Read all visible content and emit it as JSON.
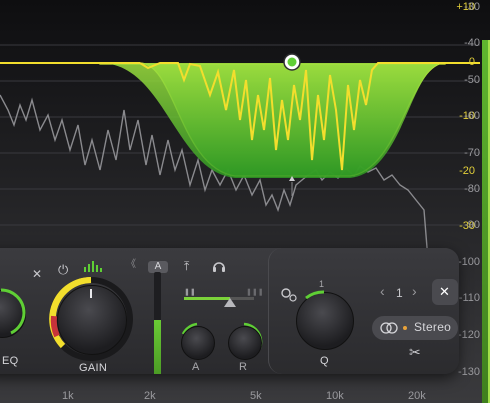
{
  "db_scale_left": [
    "+10",
    "0",
    "-10",
    "-20",
    "-30"
  ],
  "db_scale_right": [
    "-30",
    "-40",
    "-50",
    "-60",
    "-70",
    "-80",
    "-90",
    "-100",
    "-110",
    "-120",
    "-130"
  ],
  "freq_labels": [
    "1k",
    "2k",
    "5k",
    "10k",
    "20k"
  ],
  "toolbar": {
    "close_glyph": "✕",
    "power_glyph": "⏻",
    "collapse_glyph": "《",
    "ab_label": "A",
    "pin_glyph": "⤒",
    "headphones_glyph": "🎧"
  },
  "gain": {
    "label": "GAIN",
    "value_fraction": 0.62
  },
  "eq_label": "EQ",
  "attack_label": "A",
  "release_label": "R",
  "band": {
    "index": "1",
    "prev_glyph": "‹",
    "next_glyph": "›",
    "close_glyph": "✕",
    "q_label": "Q",
    "q_value_label": "1",
    "stereo_label": "Stereo",
    "scissors_glyph": "✂"
  },
  "colors": {
    "accent_green": "#7bd23a",
    "accent_yellow": "#f2de2d",
    "red": "#c8333a"
  },
  "icons": [
    "close-icon",
    "power-icon",
    "spectrum-icon",
    "collapse-icon",
    "pin-icon",
    "headphones-icon",
    "settings-icon",
    "stereo-link-icon",
    "scissors-icon"
  ]
}
